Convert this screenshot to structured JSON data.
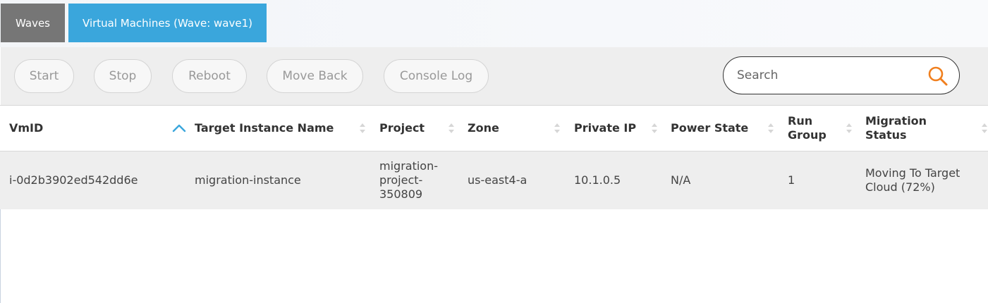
{
  "tabs": [
    {
      "label": "Waves"
    },
    {
      "label": "Virtual Machines (Wave: wave1)"
    }
  ],
  "toolbar": {
    "start_label": "Start",
    "stop_label": "Stop",
    "reboot_label": "Reboot",
    "move_back_label": "Move Back",
    "console_log_label": "Console Log"
  },
  "search": {
    "placeholder": "Search",
    "value": ""
  },
  "table": {
    "columns": [
      "VmID",
      "Target Instance Name",
      "Project",
      "Zone",
      "Private IP",
      "Power State",
      "Run Group",
      "Migration Status"
    ],
    "sorted_column": "VmID",
    "sort_direction": "ascending",
    "rows": [
      {
        "vmid": "i-0d2b3902ed542dd6e",
        "target_instance_name": "migration-instance",
        "project": "migration-project-350809",
        "zone": "us-east4-a",
        "private_ip": "10.1.0.5",
        "power_state": "N/A",
        "run_group": "1",
        "migration_status": "Moving To Target Cloud (72%)"
      }
    ]
  },
  "colors": {
    "active_tab": "#3aa6dc",
    "inactive_tab": "#767676",
    "search_icon": "#f07f1e",
    "sort_active": "#3aa6dc"
  }
}
